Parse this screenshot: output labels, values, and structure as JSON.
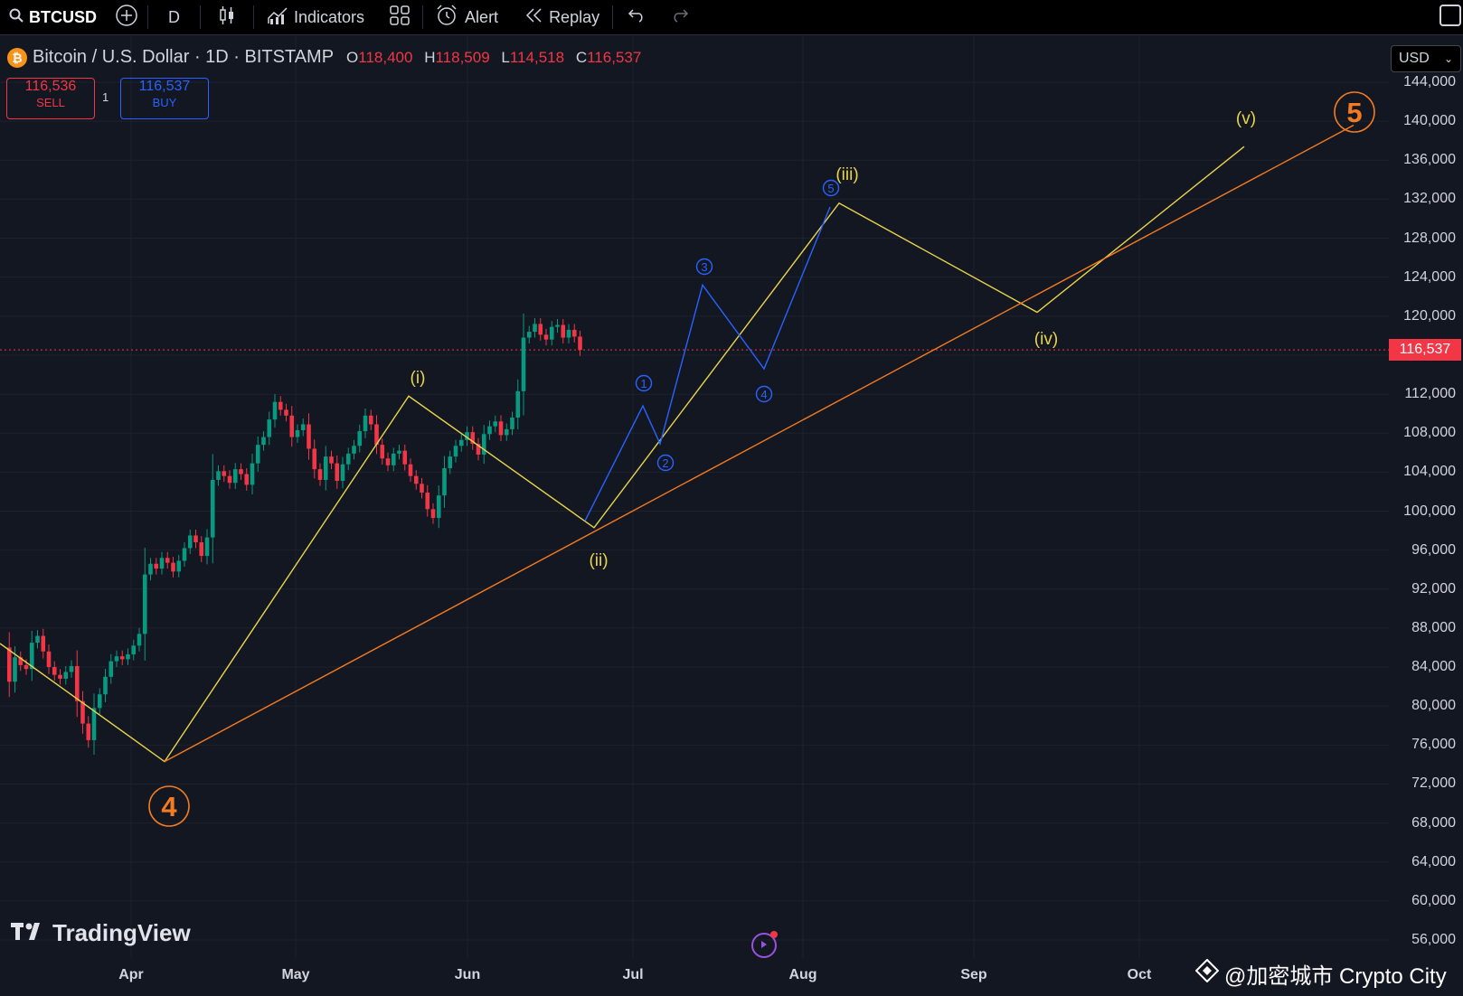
{
  "toolbar": {
    "symbol": "BTCUSD",
    "interval": "D",
    "indicators_label": "Indicators",
    "alert_label": "Alert",
    "replay_label": "Replay"
  },
  "legend": {
    "title": "Bitcoin / U.S. Dollar · 1D · BITSTAMP",
    "open_key": "O",
    "open": "118,400",
    "high_key": "H",
    "high": "118,509",
    "low_key": "L",
    "low": "114,518",
    "close_key": "C",
    "close": "116,537"
  },
  "trade": {
    "sell_price": "116,536",
    "sell_label": "SELL",
    "buy_price": "116,537",
    "buy_label": "BUY",
    "spread": "1"
  },
  "currency": "USD",
  "current_price_label": "116,537",
  "watermark": "TradingView",
  "credit": "@加密城市 Crypto City",
  "colors": {
    "up": "#089981",
    "down": "#f23645",
    "yellow": "#e8d44d",
    "orange": "#f47b20",
    "blue": "#2962ff"
  },
  "chart_data": {
    "type": "candlestick",
    "price_ticks": [
      144000,
      140000,
      136000,
      132000,
      128000,
      124000,
      120000,
      116000,
      112000,
      108000,
      104000,
      100000,
      96000,
      92000,
      88000,
      84000,
      80000,
      76000,
      72000,
      68000,
      64000,
      60000,
      56000
    ],
    "price_tick_labels": [
      "144,000",
      "140,000",
      "136,000",
      "132,000",
      "128,000",
      "124,000",
      "120,000",
      "116,000",
      "112,000",
      "108,000",
      "104,000",
      "100,000",
      "96,000",
      "92,000",
      "88,000",
      "84,000",
      "80,000",
      "76,000",
      "72,000",
      "68,000",
      "64,000",
      "60,000",
      "56,000"
    ],
    "time_labels": [
      "Apr",
      "May",
      "Jun",
      "Jul",
      "Aug",
      "Sep",
      "Oct"
    ],
    "current_price": 116537,
    "close_series": [
      86000,
      82500,
      85000,
      84200,
      83800,
      86500,
      87200,
      85600,
      84000,
      83200,
      82800,
      83500,
      84100,
      80500,
      78200,
      76500,
      79800,
      81200,
      83000,
      84600,
      85100,
      84800,
      85300,
      86200,
      87400,
      93500,
      94600,
      94100,
      95200,
      94700,
      93800,
      94900,
      96200,
      97500,
      96800,
      95400,
      97300,
      103200,
      104100,
      103600,
      102900,
      104300,
      103800,
      102700,
      104900,
      106800,
      107600,
      109400,
      111200,
      110400,
      109800,
      107600,
      108300,
      108900,
      106400,
      104300,
      103200,
      105600,
      104900,
      103100,
      104800,
      105900,
      106700,
      108200,
      109800,
      108900,
      106800,
      105400,
      104700,
      105900,
      106200,
      104800,
      103600,
      102800,
      101900,
      100200,
      99300,
      101600,
      104400,
      105600,
      106700,
      107300,
      108100,
      106900,
      105800,
      107900,
      108700,
      109200,
      107800,
      108400,
      109600,
      112300,
      117800,
      118400,
      119200,
      118100,
      117600,
      118900,
      119100,
      117800,
      118600,
      117900,
      116537
    ],
    "waves": {
      "yellow": [
        {
          "label": "4",
          "price": 74300
        },
        {
          "label": "(i)",
          "price": 111800
        },
        {
          "label": "(ii)",
          "price": 98300
        },
        {
          "label": "(iii)",
          "price": 131600
        },
        {
          "label": "(iv)",
          "price": 120400
        },
        {
          "label": "(v)",
          "price": 137400
        }
      ],
      "blue": [
        {
          "label": "1",
          "price": 110800
        },
        {
          "label": "2",
          "price": 106900
        },
        {
          "label": "3",
          "price": 123200
        },
        {
          "label": "4",
          "price": 114600
        },
        {
          "label": "5",
          "price": 131200
        }
      ],
      "orange_labels": [
        "4",
        "5"
      ]
    }
  }
}
